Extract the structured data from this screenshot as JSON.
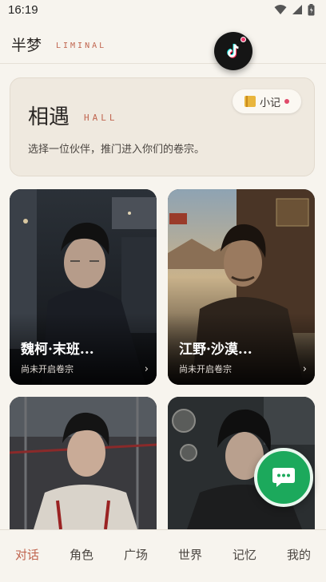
{
  "status": {
    "time": "16:19"
  },
  "header": {
    "title": "半梦",
    "subtitle": "LIMINAL"
  },
  "hall": {
    "title": "相遇",
    "tag": "HALL",
    "description": "选择一位伙伴，推门进入你们的卷宗。",
    "note_label": "小记"
  },
  "cards": [
    {
      "name": "魏柯·末班...",
      "status": "尚未开启卷宗"
    },
    {
      "name": "江野·沙漠...",
      "status": "尚未开启卷宗"
    },
    {
      "name": "",
      "status": ""
    },
    {
      "name": "",
      "status": ""
    }
  ],
  "nav": [
    "对话",
    "角色",
    "广场",
    "世界",
    "记忆",
    "我的"
  ],
  "colors": {
    "accent": "#c0654f",
    "fab": "#1ca95c",
    "background": "#f7f4ee"
  },
  "icons": {
    "tiktok": "tiktok-icon",
    "chat": "chat-bubble-icon",
    "note": "notebook-icon"
  }
}
